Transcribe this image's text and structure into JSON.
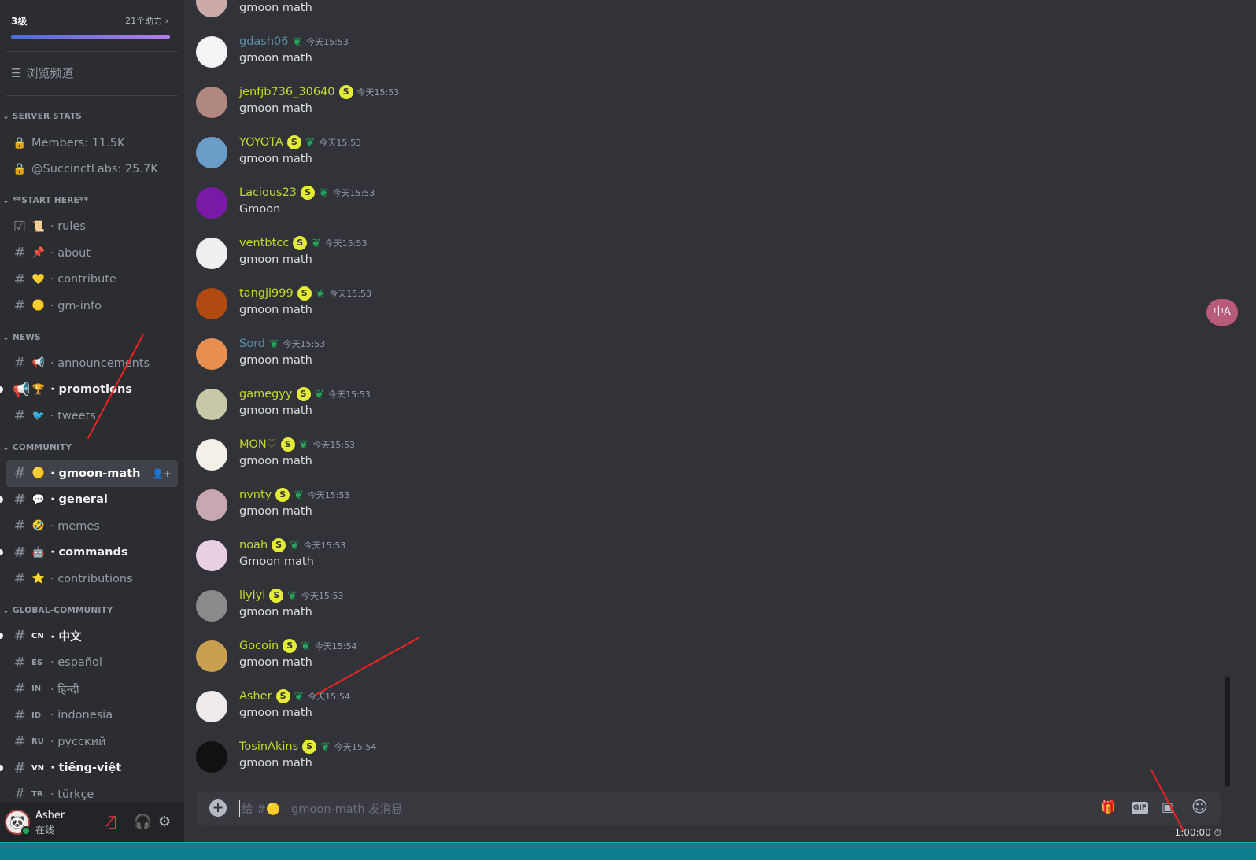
{
  "server": {
    "level": "3级",
    "boosts": "21个助力",
    "boost_progress": 0.98,
    "browse_label": "浏览频道"
  },
  "categories": [
    {
      "name": "SERVER STATS",
      "items": [
        {
          "icon": "lock-icon",
          "label": "Members: 11.5K"
        },
        {
          "icon": "lock-icon",
          "label": "@SuccinctLabs: 25.7K"
        }
      ]
    },
    {
      "name": "**START HERE**",
      "items": [
        {
          "icon": "checkbox-icon",
          "emoji": "📜",
          "label": "· rules"
        },
        {
          "icon": "hash-icon",
          "emoji": "📌",
          "label": "· about"
        },
        {
          "icon": "hash-icon",
          "emoji": "💛",
          "label": "· contribute"
        },
        {
          "icon": "hash-icon",
          "emoji": "🟡",
          "label": "· gm-info"
        }
      ]
    },
    {
      "name": "NEWS",
      "items": [
        {
          "icon": "hash-icon",
          "emoji": "📢",
          "label": "· announcements"
        },
        {
          "icon": "megaphone-icon",
          "emoji": "🏆",
          "label": "· promotions",
          "unread": true
        },
        {
          "icon": "hash-icon",
          "emoji": "🐦",
          "label": "· tweets"
        }
      ]
    },
    {
      "name": "COMMUNITY",
      "items": [
        {
          "icon": "hash-icon",
          "emoji": "🟡",
          "label": "· gmoon-math",
          "selected": true
        },
        {
          "icon": "hash-icon",
          "emoji": "💬",
          "label": "· general",
          "unread": true
        },
        {
          "icon": "hash-icon",
          "emoji": "🤣",
          "label": "· memes"
        },
        {
          "icon": "hash-icon",
          "emoji": "🤖",
          "label": "· commands",
          "unread": true
        },
        {
          "icon": "hash-icon",
          "emoji": "⭐",
          "label": "· contributions"
        }
      ]
    },
    {
      "name": "GLOBAL-COMMUNITY",
      "items": [
        {
          "icon": "hash-icon",
          "code": "CN",
          "label": "· 中文",
          "unread": true
        },
        {
          "icon": "hash-icon",
          "code": "ES",
          "label": "· español"
        },
        {
          "icon": "hash-icon",
          "code": "IN",
          "label": "· हिन्दी"
        },
        {
          "icon": "hash-icon",
          "code": "ID",
          "label": "· indonesia"
        },
        {
          "icon": "hash-icon",
          "code": "RU",
          "label": "· русский"
        },
        {
          "icon": "hash-icon",
          "code": "VN",
          "label": "· tiếng-việt",
          "unread": true
        },
        {
          "icon": "hash-icon",
          "code": "TR",
          "label": "· türkçe"
        }
      ]
    }
  ],
  "user": {
    "name": "Asher",
    "status": "在线"
  },
  "colors": {
    "name_default": "#c5d72a",
    "name_alt": "#5b8ea6",
    "sidebar": "#2b2d31",
    "main": "#313338"
  },
  "messages": [
    {
      "name": "",
      "text": "gmoon math",
      "avatar": "#caa"
    },
    {
      "name": "gdash06",
      "s": false,
      "leaf": true,
      "time": "今天15:53",
      "text": "gmoon math",
      "alt": true,
      "avatar": "#f4f4f4"
    },
    {
      "name": "jenfjb736_30640",
      "s": true,
      "leaf": false,
      "time": "今天15:53",
      "text": "gmoon math",
      "avatar": "#b08880"
    },
    {
      "name": "YOYOTA",
      "s": true,
      "leaf": true,
      "time": "今天15:53",
      "text": "gmoon math",
      "avatar": "#6a9ec8"
    },
    {
      "name": "Lacious23",
      "s": true,
      "leaf": true,
      "time": "今天15:53",
      "text": "Gmoon",
      "avatar": "#7a18a8"
    },
    {
      "name": "ventbtcc",
      "s": true,
      "leaf": true,
      "time": "今天15:53",
      "text": "gmoon math",
      "avatar": "#f0eeee"
    },
    {
      "name": "tangji999",
      "s": true,
      "leaf": true,
      "time": "今天15:53",
      "text": "gmoon math",
      "avatar": "#b04a10"
    },
    {
      "name": "Sord",
      "s": false,
      "leaf": true,
      "time": "今天15:53",
      "text": "gmoon math",
      "alt": true,
      "avatar": "#e89050"
    },
    {
      "name": "gamegyy",
      "s": true,
      "leaf": true,
      "time": "今天15:53",
      "text": "gmoon math",
      "avatar": "#c8c8a8"
    },
    {
      "name": "MON♡",
      "s": true,
      "leaf": true,
      "time": "今天15:53",
      "text": "gmoon math",
      "avatar": "#f4f0e8"
    },
    {
      "name": "nvnty",
      "s": true,
      "leaf": true,
      "time": "今天15:53",
      "text": "gmoon math",
      "avatar": "#c8a8b0"
    },
    {
      "name": "noah",
      "s": true,
      "leaf": true,
      "time": "今天15:53",
      "text": "Gmoon math",
      "avatar": "#e8d0e0"
    },
    {
      "name": "liyiyi",
      "s": true,
      "leaf": true,
      "time": "今天15:53",
      "text": "gmoon math",
      "avatar": "#8a8a8a"
    },
    {
      "name": "Gocoin",
      "s": true,
      "leaf": true,
      "time": "今天15:54",
      "text": "gmoon math",
      "avatar": "#c8a050"
    },
    {
      "name": "Asher",
      "s": true,
      "leaf": true,
      "time": "今天15:54",
      "text": "gmoon math",
      "avatar": "#f0eaea"
    },
    {
      "name": "TosinAkins",
      "s": true,
      "leaf": true,
      "time": "今天15:54",
      "text": "gmoon math",
      "avatar": "#111111"
    }
  ],
  "composer": {
    "placeholder": "给 #🟡 · gmoon-math 发消息",
    "gif": "GIF"
  },
  "timer": "1:00:00",
  "translate": "中A"
}
